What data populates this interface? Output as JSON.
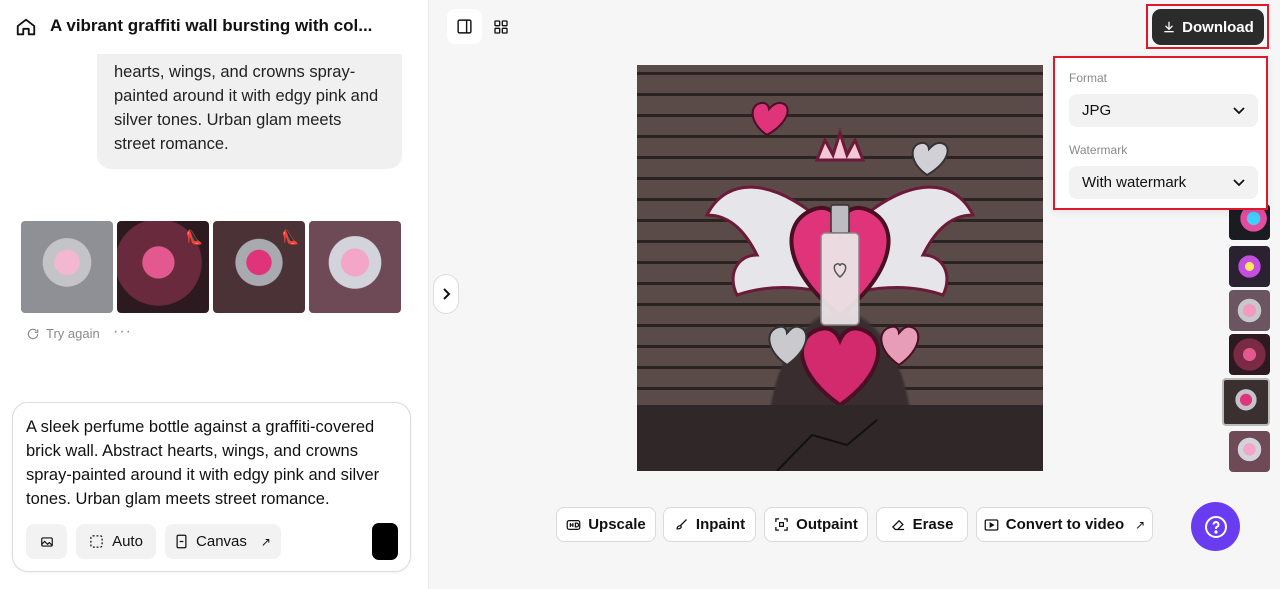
{
  "header": {
    "title": "A vibrant graffiti wall bursting with col..."
  },
  "chat": {
    "bubble_text": "hearts, wings, and crowns spray-painted around it with edgy pink and silver tones. Urban glam meets street romance.",
    "try_again_label": "Try again"
  },
  "composer": {
    "text": "A sleek perfume bottle against a graffiti-covered brick wall. Abstract hearts, wings, and crowns spray-painted around it with edgy pink and silver tones. Urban glam meets street romance.",
    "auto_label": "Auto",
    "canvas_label": "Canvas"
  },
  "toolbar": {
    "download_label": "Download"
  },
  "download_menu": {
    "format_label": "Format",
    "format_value": "JPG",
    "watermark_label": "Watermark",
    "watermark_value": "With watermark"
  },
  "actions": {
    "upscale": "Upscale",
    "inpaint": "Inpaint",
    "outpaint": "Outpaint",
    "erase": "Erase",
    "convert": "Convert to video"
  },
  "colors": {
    "accent_purple": "#6a3cf1",
    "highlight_red": "#e0182b",
    "dark_button": "#2b2b2b"
  }
}
